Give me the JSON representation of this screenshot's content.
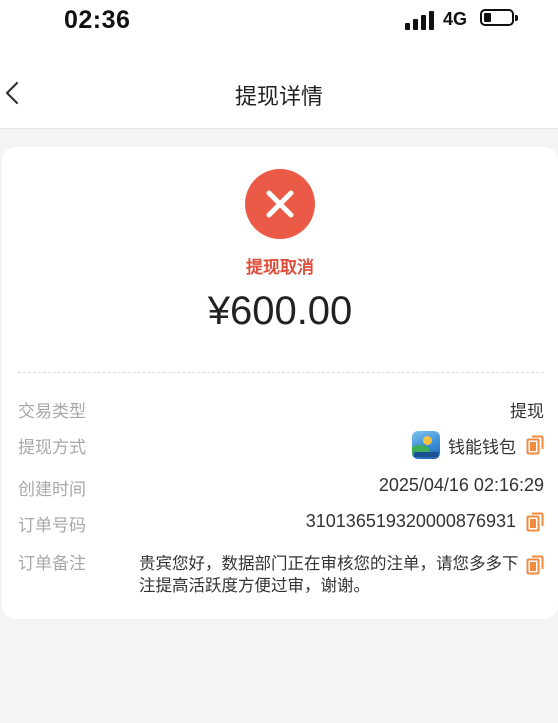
{
  "status_bar": {
    "time": "02:36",
    "network": "4G"
  },
  "header": {
    "title": "提现详情"
  },
  "status": {
    "text": "提现取消",
    "color": "#eb5a46"
  },
  "amount": "¥600.00",
  "details": {
    "type": {
      "label": "交易类型",
      "value": "提现"
    },
    "method": {
      "label": "提现方式",
      "value": "钱能钱包",
      "logo": "wallet-app-logo"
    },
    "created": {
      "label": "创建时间",
      "value": "2025/04/16 02:16:29"
    },
    "order": {
      "label": "订单号码",
      "value": "310136519320000876931"
    },
    "remark": {
      "label": "订单备注",
      "value": "贵宾您好，数据部门正在审核您的注单，请您多多下注提高活跃度方便过审，谢谢。"
    }
  },
  "colors": {
    "accent": "#f08a3c",
    "error": "#eb5a46"
  }
}
